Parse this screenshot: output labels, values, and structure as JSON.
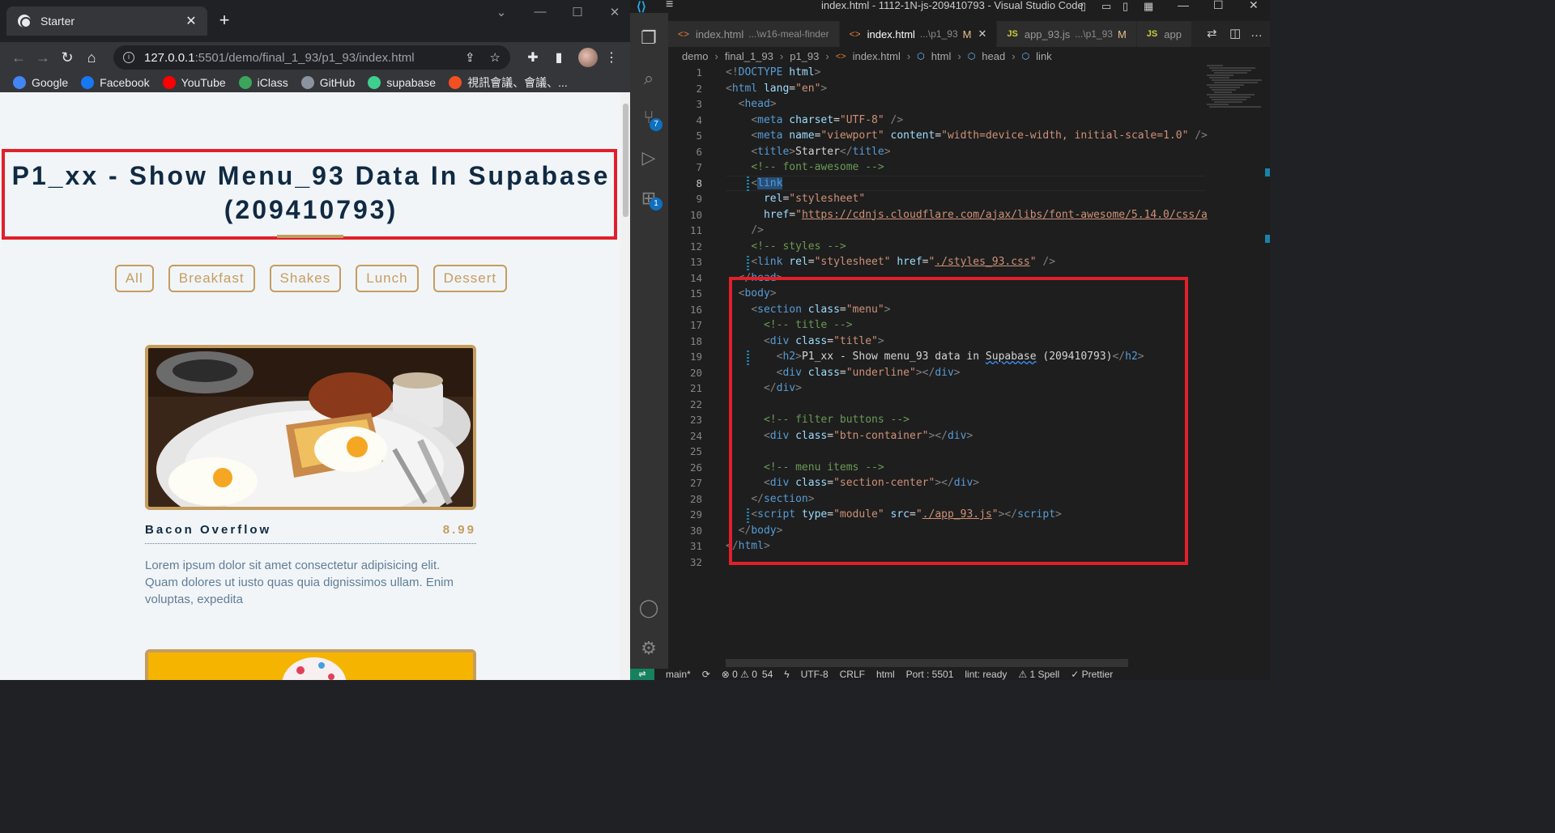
{
  "browser": {
    "tab_title": "Starter",
    "tab_close": "✕",
    "new_tab": "+",
    "url_host": "127.0.0.1",
    "url_rest": ":5501/demo/final_1_93/p1_93/index.html",
    "bookmarks": [
      {
        "label": "Google",
        "color": "#4285f4"
      },
      {
        "label": "Facebook",
        "color": "#1877f2"
      },
      {
        "label": "YouTube",
        "color": "#ff0000"
      },
      {
        "label": "iClass",
        "color": "#3ba55c"
      },
      {
        "label": "GitHub",
        "color": "#8b949e"
      },
      {
        "label": "supabase",
        "color": "#3ecf8e"
      },
      {
        "label": "視訊會議、會議、...",
        "color": "#f25022"
      }
    ]
  },
  "page": {
    "title_line1": "P1_xx - Show Menu_93 Data In Supabase",
    "title_line2": "(209410793)",
    "filters": [
      "All",
      "Breakfast",
      "Shakes",
      "Lunch",
      "Dessert"
    ],
    "items": [
      {
        "name": "Bacon Overflow",
        "price": "8.99",
        "desc": "Lorem ipsum dolor sit amet consectetur adipisicing elit. Quam dolores ut iusto quas quia dignissimos ullam. Enim voluptas, expedita"
      }
    ],
    "accent": "#c59d5f",
    "heading_color": "#102a42"
  },
  "vscode": {
    "window_title": "index.html - 1112-1N-js-209410793 - Visual Studio Code",
    "tabs": [
      {
        "label": "index.html",
        "desc": "...\\w16-meal-finder",
        "kind": "html",
        "active": false,
        "modified": false
      },
      {
        "label": "index.html",
        "desc": "...\\p1_93",
        "kind": "html",
        "active": true,
        "modified": true
      },
      {
        "label": "app_93.js",
        "desc": "...\\p1_93",
        "kind": "js",
        "active": false,
        "modified": true
      },
      {
        "label": "app",
        "desc": "",
        "kind": "js",
        "active": false,
        "modified": false
      }
    ],
    "breadcrumb": [
      "demo",
      "final_1_93",
      "p1_93",
      "index.html",
      "html",
      "head",
      "link"
    ],
    "badges": {
      "scm": "7",
      "extensions": "1"
    },
    "line_numbers": [
      "1",
      "2",
      "3",
      "4",
      "5",
      "6",
      "7",
      "8",
      "9",
      "10",
      "11",
      "12",
      "13",
      "14",
      "15",
      "16",
      "17",
      "18",
      "19",
      "20",
      "21",
      "22",
      "23",
      "24",
      "25",
      "26",
      "27",
      "28",
      "29",
      "30",
      "31",
      "32"
    ],
    "code": {
      "l1_doctype": "DOCTYPE",
      "l1_html": "html",
      "l2_attr": "lang",
      "l2_val": "\"en\"",
      "l4_val": "\"UTF-8\"",
      "l5_name_val": "\"viewport\"",
      "l5_content_val": "\"width=device-width, initial-scale=1.0\"",
      "l6_text": "Starter",
      "l7_comment": "<!-- font-awesome -->",
      "l9_val": "\"stylesheet\"",
      "l10_url": "https://cdnjs.cloudflare.com/ajax/libs/font-awesome/5.14.0/css/a",
      "l12_comment": "<!-- styles -->",
      "l13_href": "./styles_93.css",
      "l16_class": "\"menu\"",
      "l17_comment": "<!-- title -->",
      "l18_class": "\"title\"",
      "l19_text_a": "P1_xx - Show menu_93 data in ",
      "l19_spell": "Supabase",
      "l19_text_b": " (209410793)",
      "l20_class": "\"underline\"",
      "l23_comment": "<!-- filter buttons -->",
      "l24_class": "\"btn-container\"",
      "l26_comment": "<!-- menu items -->",
      "l27_class": "\"section-center\"",
      "l29_type": "\"module\"",
      "l29_src": "./app_93.js"
    },
    "status": {
      "remote": "⇌",
      "branch": "main*",
      "sync": "⟳",
      "problems": "⊗ 0 ⚠ 0",
      "ports": "54",
      "encoding": "UTF-8",
      "eol": "CRLF",
      "language": "html",
      "port": "Port : 5501",
      "lint": "lint: ready",
      "spell": "⚠ 1 Spell",
      "prettier": "✓ Prettier"
    }
  }
}
